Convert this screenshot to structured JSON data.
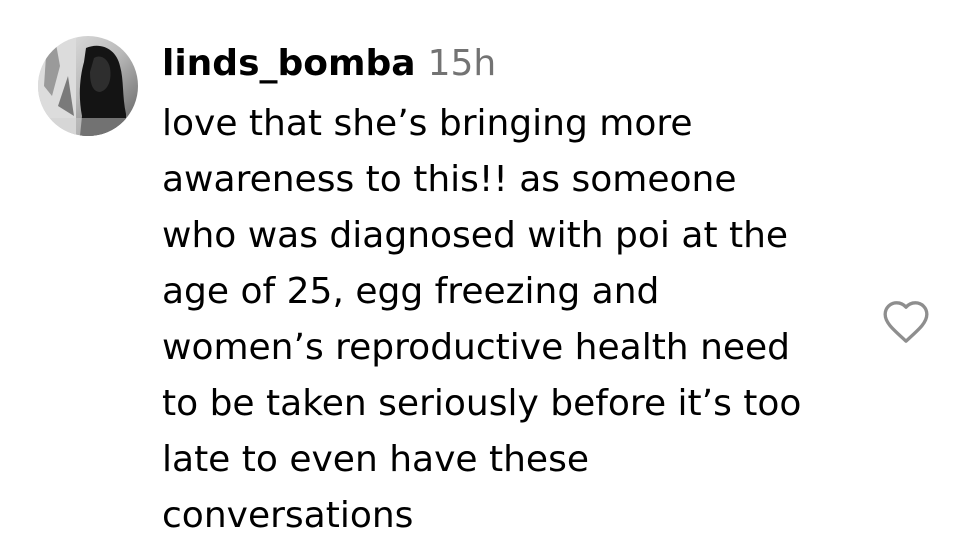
{
  "comment": {
    "username": "linds_bomba",
    "timestamp": "15h",
    "text_lines": [
      "love that she’s bringing more",
      "awareness to this!! as someone",
      "who was diagnosed with poi at the",
      "age of 25, egg freezing and",
      "women’s reproductive health need",
      "to be taken seriously before it’s too",
      "late to even have these",
      "conversations"
    ]
  },
  "icons": {
    "avatar": "profile-photo",
    "like": "heart-outline-icon"
  },
  "colors": {
    "text": "#000000",
    "timestamp": "#737373",
    "icon_stroke": "#8e8e8e"
  }
}
